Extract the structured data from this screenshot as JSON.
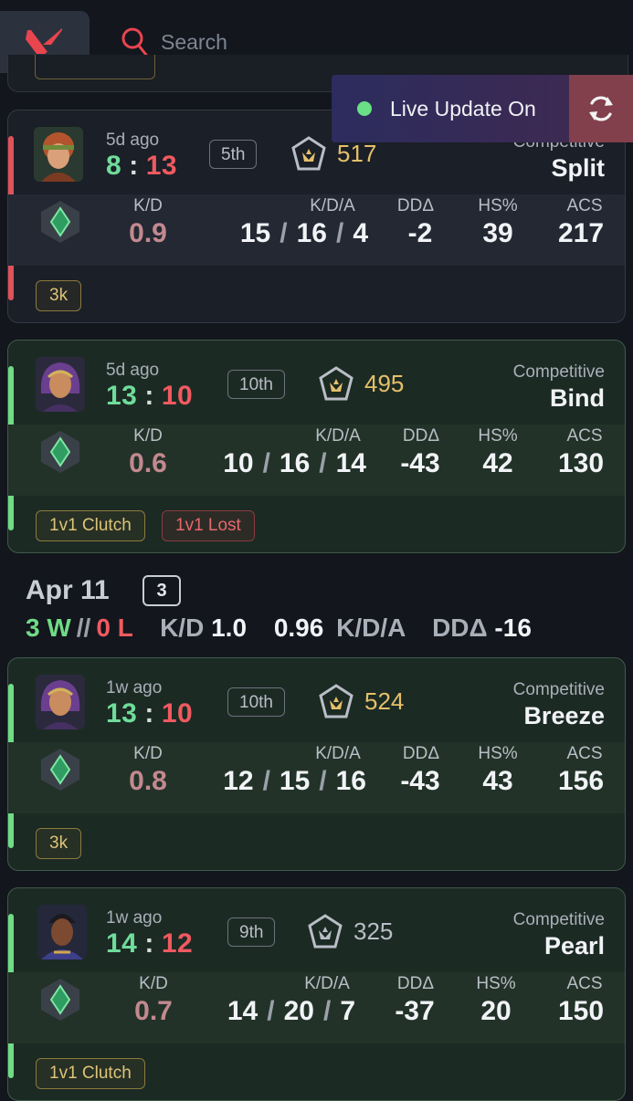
{
  "header": {
    "search_placeholder": "Search"
  },
  "live": {
    "label": "Live Update On"
  },
  "labels": {
    "kd": "K/D",
    "kda": "K/D/A",
    "dd": "DDΔ",
    "hs": "HS%",
    "acs": "ACS"
  },
  "matches": [
    {
      "ago": "5d ago",
      "won": "8",
      "lost": "13",
      "place": "5th",
      "rr": "517",
      "mode": "Competitive",
      "map": "Split",
      "kd": "0.9",
      "k": "15",
      "d": "16",
      "a": "4",
      "dd": "-2",
      "hs": "39",
      "acs": "217",
      "badges": [
        "3k"
      ]
    },
    {
      "ago": "5d ago",
      "won": "13",
      "lost": "10",
      "place": "10th",
      "rr": "495",
      "mode": "Competitive",
      "map": "Bind",
      "kd": "0.6",
      "k": "10",
      "d": "16",
      "a": "14",
      "dd": "-43",
      "hs": "42",
      "acs": "130",
      "badges": [
        "1v1 Clutch",
        "1v1 Lost"
      ]
    },
    {
      "ago": "1w ago",
      "won": "13",
      "lost": "10",
      "place": "10th",
      "rr": "524",
      "mode": "Competitive",
      "map": "Breeze",
      "kd": "0.8",
      "k": "12",
      "d": "15",
      "a": "16",
      "dd": "-43",
      "hs": "43",
      "acs": "156",
      "badges": [
        "3k"
      ]
    },
    {
      "ago": "1w ago",
      "won": "14",
      "lost": "12",
      "place": "9th",
      "rr": "325",
      "mode": "Competitive",
      "map": "Pearl",
      "kd": "0.7",
      "k": "14",
      "d": "20",
      "a": "7",
      "dd": "-37",
      "hs": "20",
      "acs": "150",
      "badges": [
        "1v1 Clutch"
      ]
    }
  ],
  "day": {
    "date": "Apr 11",
    "count": "3",
    "wins": "3 W",
    "sep": "//",
    "losses": "0 L",
    "kd_label": "K/D",
    "kd": "1.0",
    "kda_value": "0.96",
    "kda_label": "K/D/A",
    "dd_label": "DDΔ",
    "dd": "-16"
  },
  "colors": {
    "win": "#6fdc86",
    "loss": "#ef5a60",
    "rr_gold": "#e4c06a",
    "accent_red": "#e8454f"
  }
}
